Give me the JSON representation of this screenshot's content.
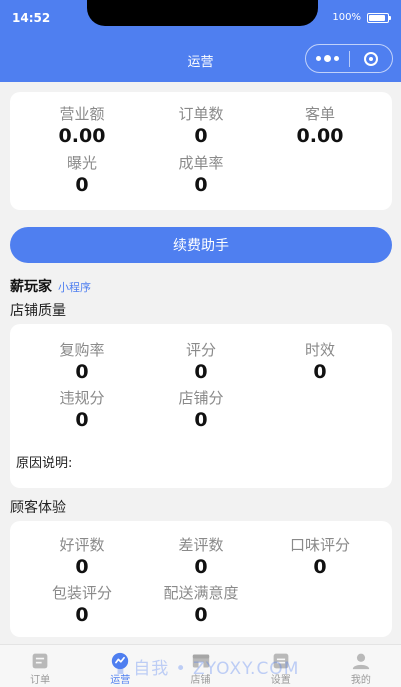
{
  "status": {
    "time": "14:52",
    "battery": "100%"
  },
  "nav": {
    "title": "运营"
  },
  "summary": {
    "revenue": {
      "label": "营业额",
      "value": "0.00"
    },
    "orders": {
      "label": "订单数",
      "value": "0"
    },
    "avg_order": {
      "label": "客单",
      "value": "0.00"
    },
    "exposure": {
      "label": "曝光",
      "value": "0"
    },
    "conversion": {
      "label": "成单率",
      "value": "0"
    }
  },
  "renew_button": "续费助手",
  "shop": {
    "name": "薪玩家",
    "tag": "小程序"
  },
  "quality": {
    "title": "店铺质量",
    "repurchase": {
      "label": "复购率",
      "value": "0"
    },
    "rating": {
      "label": "评分",
      "value": "0"
    },
    "timeliness": {
      "label": "时效",
      "value": "0"
    },
    "violation": {
      "label": "违规分",
      "value": "0"
    },
    "shop_score": {
      "label": "店铺分",
      "value": "0"
    },
    "reason_label": "原因说明:"
  },
  "experience": {
    "title": "顾客体验",
    "good_reviews": {
      "label": "好评数",
      "value": "0"
    },
    "bad_reviews": {
      "label": "差评数",
      "value": "0"
    },
    "taste": {
      "label": "口味评分",
      "value": "0"
    },
    "packaging": {
      "label": "包装评分",
      "value": "0"
    },
    "delivery": {
      "label": "配送满意度",
      "value": "0"
    }
  },
  "tabbar": {
    "items": [
      {
        "label": "订单",
        "icon": "order-icon"
      },
      {
        "label": "运营",
        "icon": "operation-icon"
      },
      {
        "label": "店铺",
        "icon": "shop-icon"
      },
      {
        "label": "设置",
        "icon": "settings-icon"
      },
      {
        "label": "我的",
        "icon": "profile-icon"
      }
    ],
    "active_color": "#4f7ff0",
    "inactive_color": "#999999"
  },
  "watermark": "∎ 自我 • ZYOXY.COM",
  "colors": {
    "primary": "#4f7ff0",
    "background": "#f2f2f2"
  }
}
